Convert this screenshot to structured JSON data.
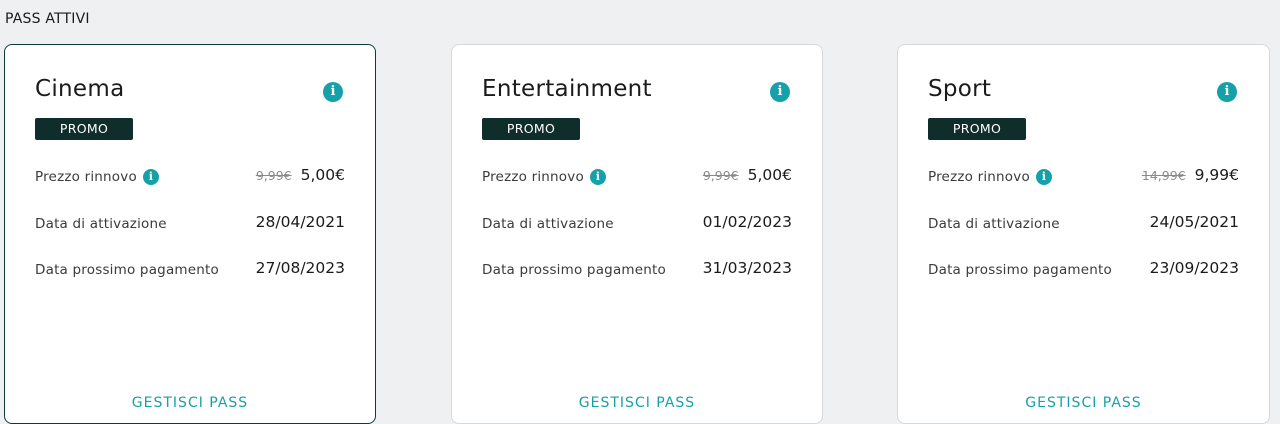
{
  "section_title": "PASS ATTIVI",
  "colors": {
    "accent": "#15a1aa",
    "promo_bg": "#0f2d2b",
    "page_bg": "#eff0f1"
  },
  "cards": [
    {
      "title": "Cinema",
      "promo": "PROMO",
      "renewal_label": "Prezzo rinnovo",
      "old_price": "9,99€",
      "new_price": "5,00€",
      "activation_label": "Data di attivazione",
      "activation_date": "28/04/2021",
      "next_payment_label": "Data prossimo pagamento",
      "next_payment_date": "27/08/2023",
      "manage_label": "GESTISCI PASS"
    },
    {
      "title": "Entertainment",
      "promo": "PROMO",
      "renewal_label": "Prezzo rinnovo",
      "old_price": "9,99€",
      "new_price": "5,00€",
      "activation_label": "Data di attivazione",
      "activation_date": "01/02/2023",
      "next_payment_label": "Data prossimo pagamento",
      "next_payment_date": "31/03/2023",
      "manage_label": "GESTISCI PASS"
    },
    {
      "title": "Sport",
      "promo": "PROMO",
      "renewal_label": "Prezzo rinnovo",
      "old_price": "14,99€",
      "new_price": "9,99€",
      "activation_label": "Data di attivazione",
      "activation_date": "24/05/2021",
      "next_payment_label": "Data prossimo pagamento",
      "next_payment_date": "23/09/2023",
      "manage_label": "GESTISCI PASS"
    }
  ],
  "icons": {
    "info": "info-icon"
  }
}
